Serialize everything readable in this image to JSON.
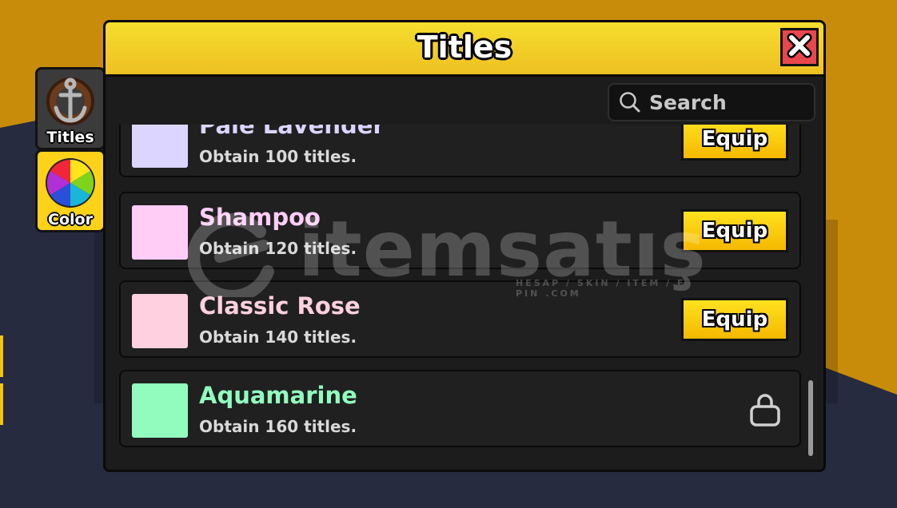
{
  "side_tabs": [
    {
      "label": "Titles",
      "icon": "anchor-icon"
    },
    {
      "label": "Color",
      "icon": "color-wheel-icon"
    }
  ],
  "panel": {
    "title": "Titles",
    "close_icon": "close-icon",
    "search": {
      "placeholder": "Search",
      "icon": "search-icon"
    }
  },
  "items": [
    {
      "name": "Pale Lavender",
      "desc": "Obtain 100 titles.",
      "color": "#dcd5ff",
      "action": "Equip",
      "locked": false
    },
    {
      "name": "Shampoo",
      "desc": "Obtain 120 titles.",
      "color": "#ffcdf6",
      "action": "Equip",
      "locked": false
    },
    {
      "name": "Classic Rose",
      "desc": "Obtain 140 titles.",
      "color": "#ffd0df",
      "action": "Equip",
      "locked": false
    },
    {
      "name": "Aquamarine",
      "desc": "Obtain 160 titles.",
      "color": "#92fcbf",
      "action": "",
      "locked": true
    }
  ],
  "watermark": {
    "text": "itemsatış",
    "subtext": "HESAP / SKIN / ITEM / E-PIN .COM"
  }
}
